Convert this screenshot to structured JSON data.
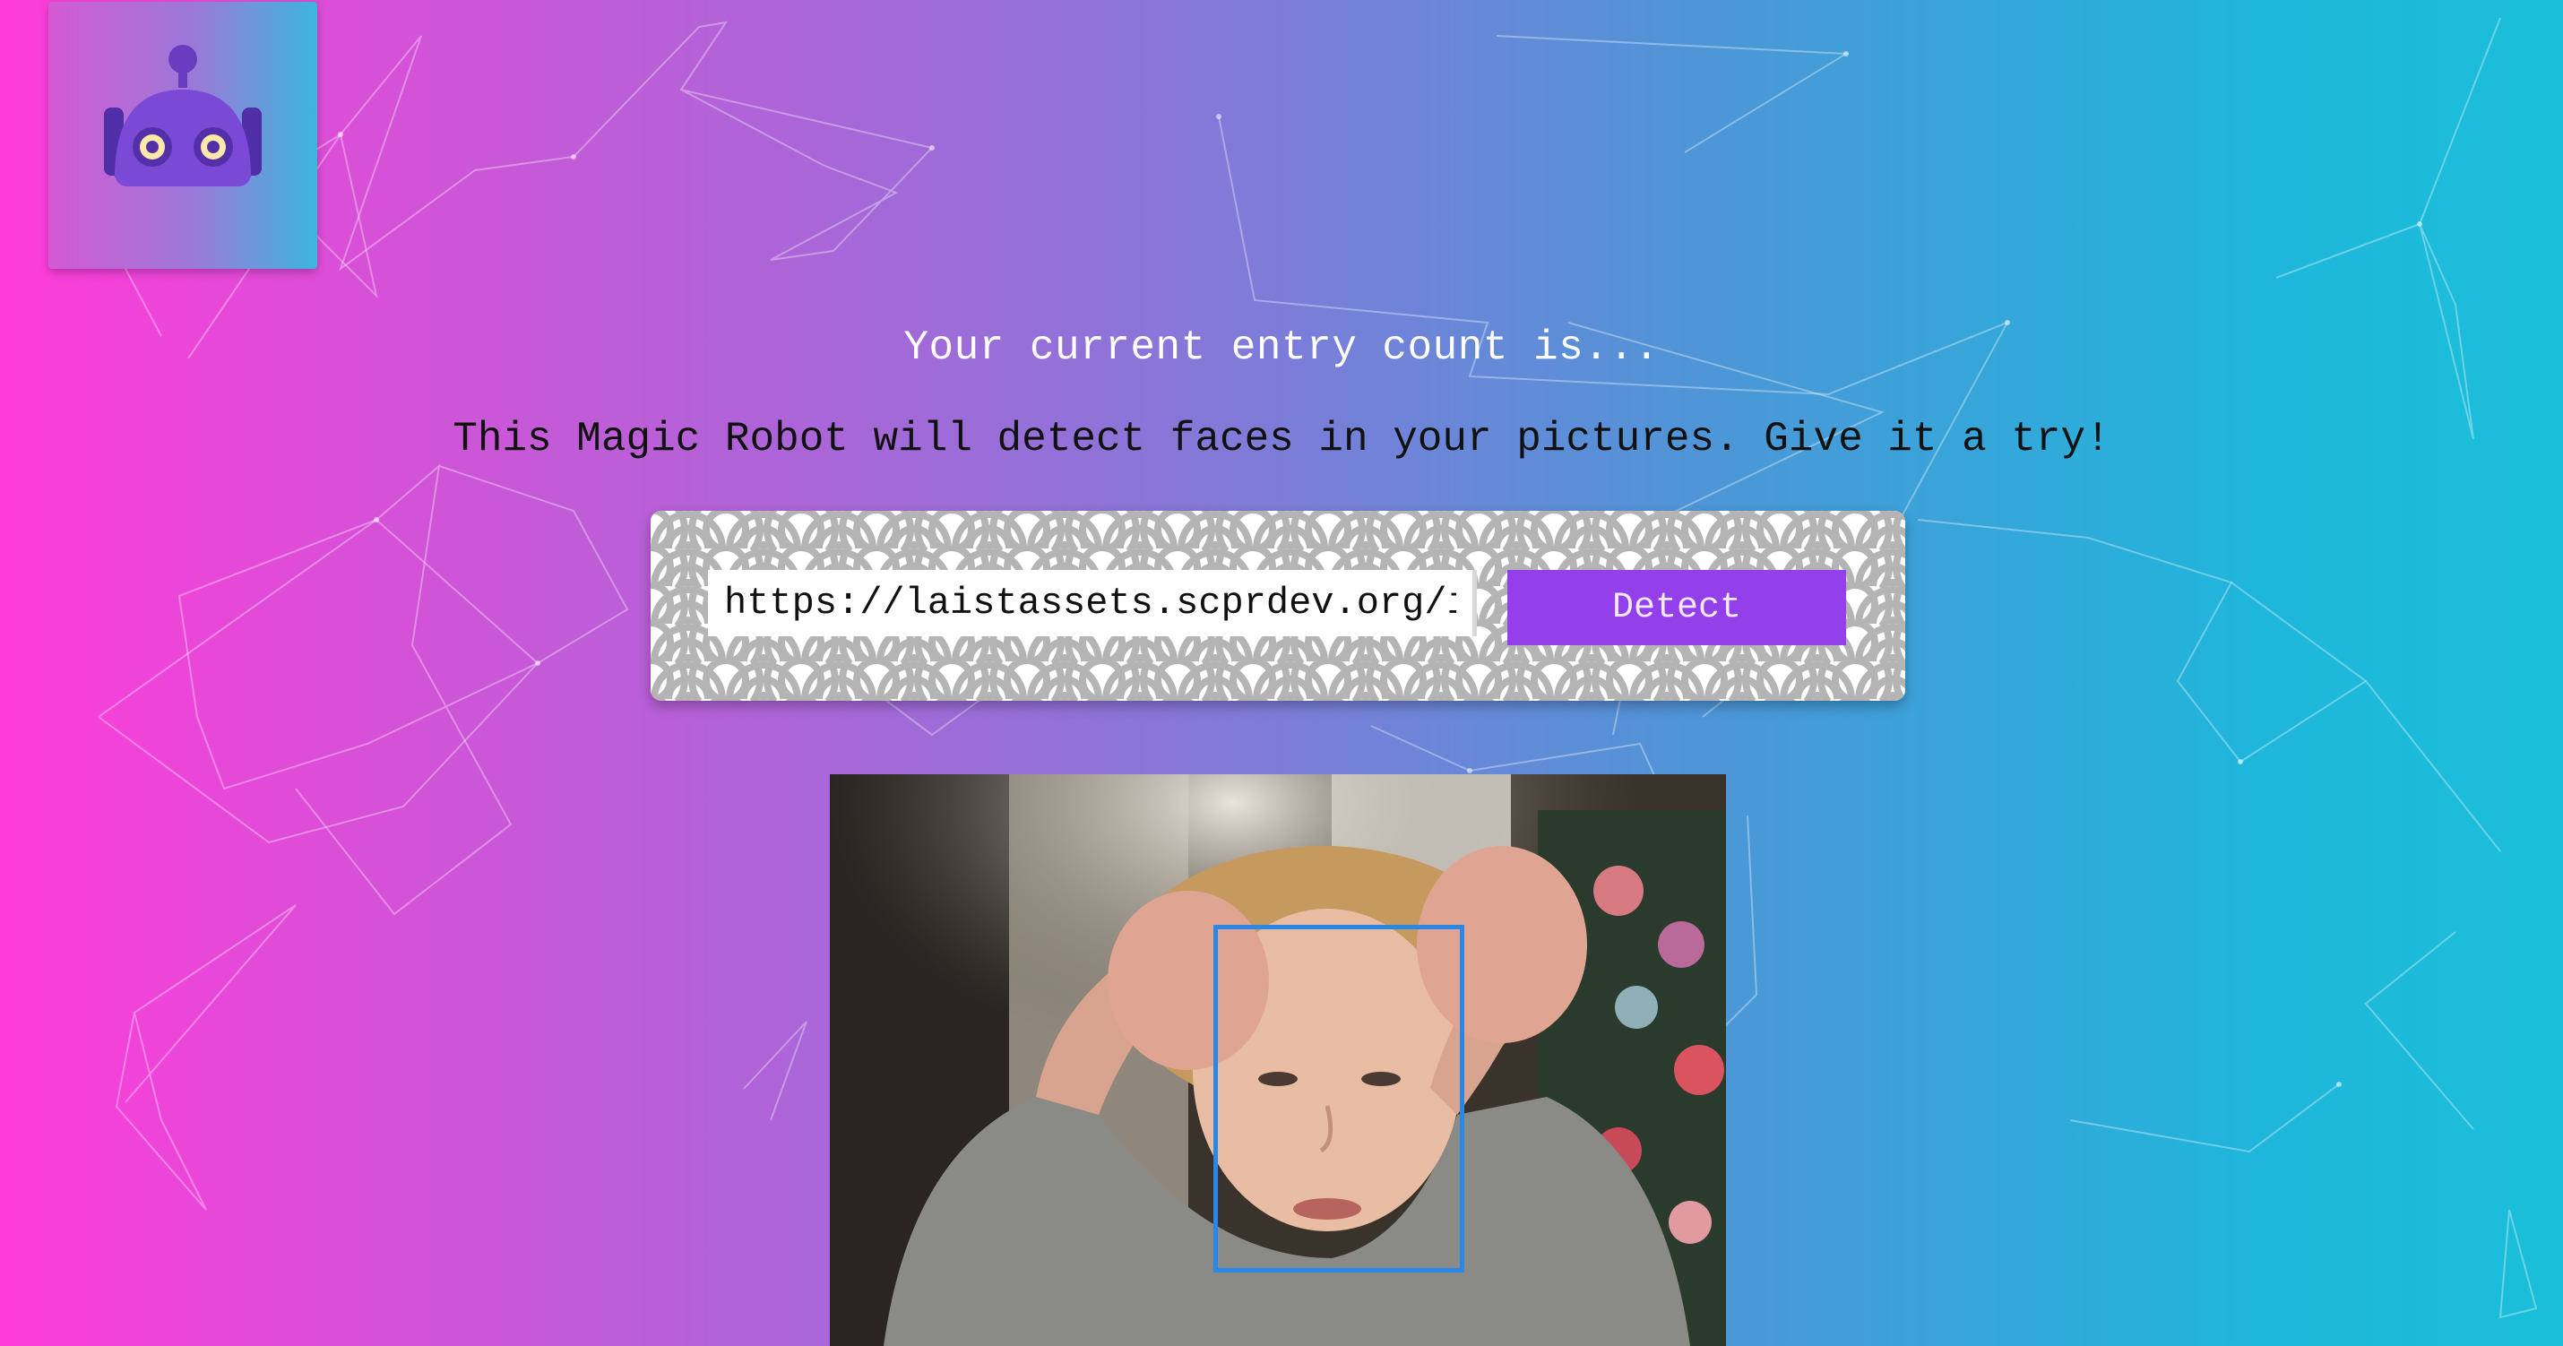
{
  "header": {
    "logo": "robot-icon"
  },
  "status": {
    "entry_count_text": "Your current entry count is..."
  },
  "hero": {
    "tagline": "This Magic Robot will detect faces in your pictures. Give it a try!"
  },
  "detect_form": {
    "url_value": "https://laistassets.scprdev.org/i/a",
    "button_label": "Detect"
  },
  "result": {
    "faces_detected": 1
  },
  "colors": {
    "gradient_left": "#ff3cd9",
    "gradient_right": "#1abfd9",
    "button": "#9340ea",
    "face_box": "#2a87e6"
  }
}
